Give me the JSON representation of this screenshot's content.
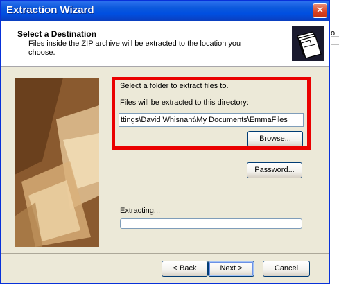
{
  "window": {
    "title": "Extraction Wizard",
    "close_glyph": "✕"
  },
  "header": {
    "title": "Select a Destination",
    "description": "Files inside the ZIP archive will be extracted to the location you choose.",
    "icon": "folder-stack-icon"
  },
  "destination": {
    "select_label": "Select a folder to extract files to.",
    "directory_label": "Files will be extracted to this directory:",
    "path_value": "ttings\\David Whisnant\\My Documents\\EmmaFiles",
    "browse_label": "Browse..."
  },
  "password_label": "Password...",
  "progress": {
    "label": "Extracting...",
    "value": 0
  },
  "footer": {
    "back_label": "< Back",
    "next_label": "Next >",
    "cancel_label": "Cancel"
  },
  "background": {
    "fragment_text": "o"
  },
  "colors": {
    "titlebar": "#0c59dc",
    "dialog_face": "#ece9d8",
    "highlight": "#ea0000",
    "field_border": "#7f9db9"
  }
}
